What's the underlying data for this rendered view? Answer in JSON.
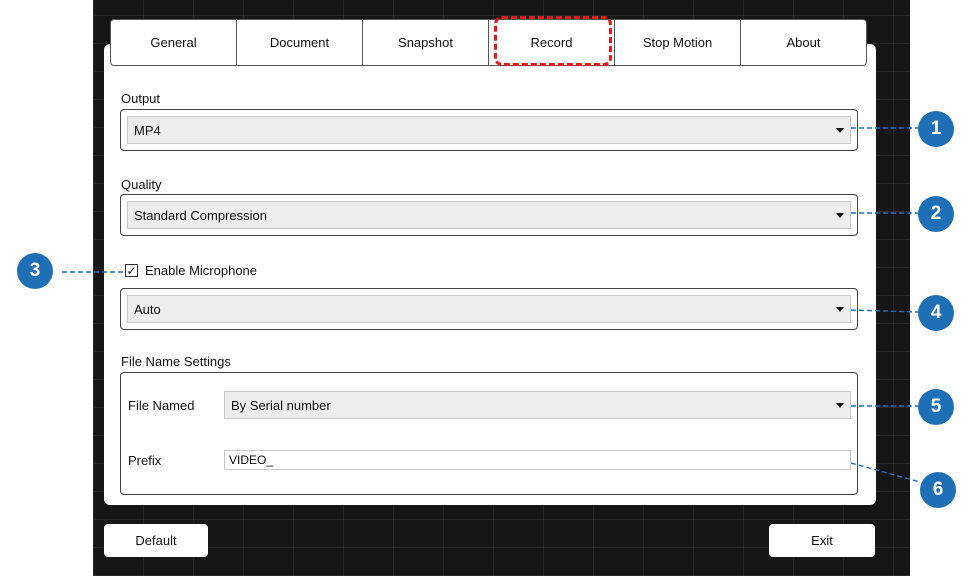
{
  "tabs": [
    "General",
    "Document",
    "Snapshot",
    "Record",
    "Stop Motion",
    "About"
  ],
  "selected_tab": "Record",
  "output": {
    "label": "Output",
    "value": "MP4"
  },
  "quality": {
    "label": "Quality",
    "value": "Standard Compression"
  },
  "microphone": {
    "label": "Enable Microphone",
    "checked": true,
    "check_glyph": "✓",
    "device": "Auto"
  },
  "file_name": {
    "section_label": "File Name Settings",
    "named_label": "File Named",
    "named_value": "By Serial number",
    "prefix_label": "Prefix",
    "prefix_value": "VIDEO_"
  },
  "buttons": {
    "default": "Default",
    "exit": "Exit"
  },
  "callouts": [
    "1",
    "2",
    "3",
    "4",
    "5",
    "6"
  ],
  "colors": {
    "callout": "#1f6fb6",
    "highlight": "#e01b1b"
  }
}
